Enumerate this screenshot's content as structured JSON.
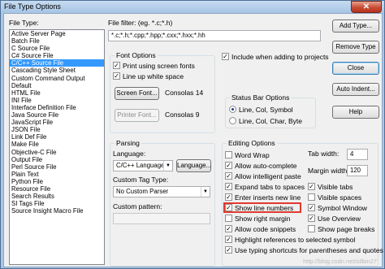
{
  "window": {
    "title": "File Type Options",
    "close_glyph": "✕"
  },
  "file_type": {
    "label": "File Type:",
    "items": [
      "Active Server Page",
      "Batch File",
      "C Source File",
      "C# Source File",
      "C/C++ Source File",
      "Cascading Style Sheet",
      "Custom Command Output",
      "Default",
      "HTML File",
      "INI File",
      "Interface Definition File",
      "Java Source File",
      "JavaScript File",
      "JSON File",
      "Link Def File",
      "Make File",
      "Objective-C File",
      "Output File",
      "Perl Source File",
      "Plain Text",
      "Python File",
      "Resource File",
      "Search Results",
      "SI Tags File",
      "Source Insight Macro File"
    ],
    "selected_index": 4
  },
  "file_filter": {
    "label": "File filter: (eg. *.c;*.h)",
    "value": "*.c;*.h;*.cpp;*.hpp;*.cxx;*.hxx;*.hh"
  },
  "buttons": {
    "add_type": "Add Type...",
    "remove_type": "Remove Type",
    "close": "Close",
    "auto_indent": "Auto Indent...",
    "help": "Help"
  },
  "include_projects": {
    "label": "Include when adding to projects",
    "checked": true
  },
  "font_options": {
    "title": "Font Options",
    "print_screen_fonts": {
      "label": "Print using screen fonts",
      "checked": true
    },
    "line_up_white": {
      "label": "Line up white space",
      "checked": true
    },
    "screen_font_button": "Screen Font...",
    "screen_font_value": "Consolas 14",
    "printer_font_button": "Printer Font...",
    "printer_font_value": "Consolas 9"
  },
  "status_bar": {
    "title": "Status Bar Options",
    "options": [
      {
        "label": "Line, Col, Symbol",
        "selected": true
      },
      {
        "label": "Line, Col, Char, Byte",
        "selected": false
      }
    ]
  },
  "parsing": {
    "title": "Parsing",
    "language_label": "Language:",
    "language_value": "C/C++ Language",
    "language_button": "Language...",
    "custom_tag_label": "Custom Tag Type:",
    "custom_tag_value": "No Custom Parser",
    "custom_pattern_label": "Custom pattern:",
    "custom_pattern_value": ""
  },
  "editing": {
    "title": "Editing Options",
    "checks": [
      {
        "label": "Word Wrap",
        "checked": false
      },
      {
        "label": "Allow auto-complete",
        "checked": true
      },
      {
        "label": "Allow intelligent paste",
        "checked": true
      },
      {
        "label": "Expand tabs to spaces",
        "checked": true
      },
      {
        "label": "Enter inserts new line",
        "checked": true
      },
      {
        "label": "Show line numbers",
        "checked": true
      },
      {
        "label": "Show right margin",
        "checked": false
      },
      {
        "label": "Allow code snippets",
        "checked": true
      },
      {
        "label": "Highlight references to selected symbol",
        "checked": true
      },
      {
        "label": "Use typing shortcuts for parentheses and quotes",
        "checked": true
      }
    ],
    "tab_width_label": "Tab width:",
    "tab_width_value": "4",
    "margin_width_label": "Margin width:",
    "margin_width_value": "120",
    "right_checks": [
      {
        "label": "Visible tabs",
        "checked": true
      },
      {
        "label": "Visible spaces",
        "checked": false
      },
      {
        "label": "Symbol Window",
        "checked": true
      },
      {
        "label": "Use Overview",
        "checked": true
      },
      {
        "label": "Show page breaks",
        "checked": false
      }
    ]
  },
  "watermark": "http://blog.csdn.net/silbin27",
  "colors": {
    "highlight": "#e03a2f",
    "selection": "#3399ff"
  }
}
